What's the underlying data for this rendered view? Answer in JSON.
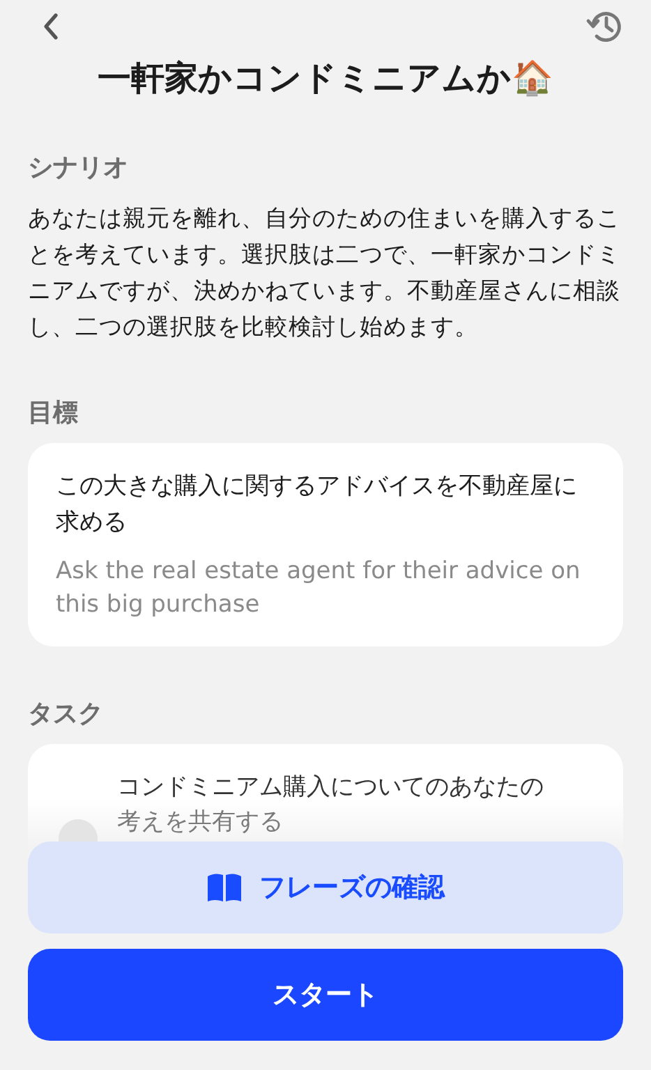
{
  "title": "一軒家かコンドミニアムか🏠",
  "scenario": {
    "heading": "シナリオ",
    "text": "あなたは親元を離れ、自分のための住まいを購入することを考えています。選択肢は二つで、一軒家かコンドミニアムですが、決めかねています。不動産屋さんに相談し、二つの選択肢を比較検討し始めます。"
  },
  "goal": {
    "heading": "目標",
    "text": "この大きな購入に関するアドバイスを不動産屋に求める",
    "translation": "Ask the real estate agent for their advice on this big purchase"
  },
  "tasks": {
    "heading": "タスク",
    "items": [
      {
        "text": "コンドミニアム購入についてのあなたの",
        "text_faded": "考えを共有する"
      }
    ]
  },
  "buttons": [
    {
      "kind": "secondary",
      "label": "フレーズの確認"
    },
    {
      "kind": "primary",
      "label": "スタート"
    }
  ]
}
